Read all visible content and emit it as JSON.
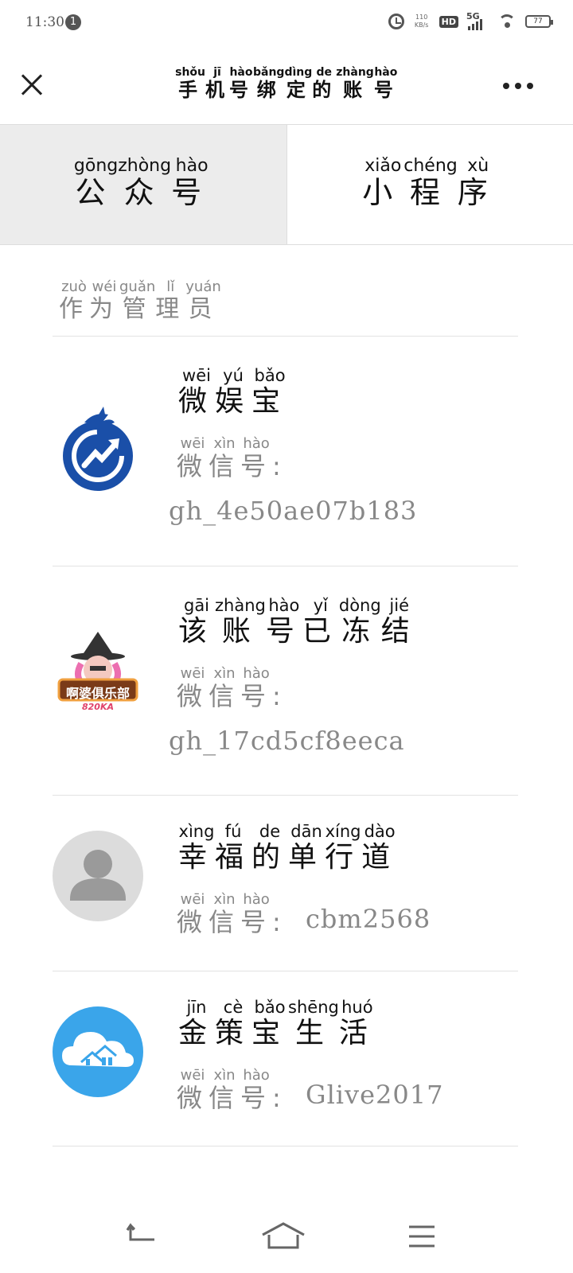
{
  "status_bar": {
    "time": "11:30",
    "notification_count": "1",
    "speed_value": "110",
    "speed_unit": "KB/s",
    "hd_label": "HD",
    "network_label": "5G",
    "battery_level": "77"
  },
  "header": {
    "title_chars": [
      "手",
      "机",
      "号",
      "绑",
      "定",
      "的",
      "账",
      "号"
    ],
    "title_pinyin": [
      "shǒu",
      "jī",
      "hào",
      "bǎng",
      "dìng",
      "de",
      "zhàng",
      "hào"
    ]
  },
  "tabs": [
    {
      "label_chars": [
        "公",
        "众",
        "号"
      ],
      "label_pinyin": [
        "gōng",
        "zhòng",
        "hào"
      ],
      "active": true
    },
    {
      "label_chars": [
        "小",
        "程",
        "序"
      ],
      "label_pinyin": [
        "xiǎo",
        "chéng",
        "xù"
      ],
      "active": false
    }
  ],
  "section": {
    "chars": [
      "作",
      "为",
      "管",
      "理",
      "员"
    ],
    "pinyin": [
      "zuò",
      "wéi",
      "guǎn",
      "lǐ",
      "yuán"
    ]
  },
  "wx_label": {
    "chars": [
      "微",
      "信",
      "号"
    ],
    "pinyin": [
      "wēi",
      "xìn",
      "hào"
    ],
    "colon": ":"
  },
  "accounts": [
    {
      "name_chars": [
        "微",
        "娱",
        "宝"
      ],
      "name_pinyin": [
        "wēi",
        "yú",
        "bǎo"
      ],
      "wechat_id": "gh_4e50ae07b183",
      "avatar": "dragon-logo-icon"
    },
    {
      "name_chars": [
        "该",
        "账",
        "号",
        "已",
        "冻",
        "结"
      ],
      "name_pinyin": [
        "gāi",
        "zhàng",
        "hào",
        "yǐ",
        "dòng",
        "jié"
      ],
      "wechat_id": "gh_17cd5cf8eeca",
      "avatar": "club-logo-icon",
      "avatar_text": "啊婆俱乐部",
      "avatar_subtext": "820KA"
    },
    {
      "name_chars": [
        "幸",
        "福",
        "的",
        "单",
        "行",
        "道"
      ],
      "name_pinyin": [
        "xìng",
        "fú",
        "de",
        "dān",
        "xíng",
        "dào"
      ],
      "wechat_id": "cbm2568",
      "avatar": "default-user-icon"
    },
    {
      "name_chars": [
        "金",
        "策",
        "宝",
        "生",
        "活"
      ],
      "name_pinyin": [
        "jīn",
        "cè",
        "bǎo",
        "shēng",
        "huó"
      ],
      "wechat_id": "Glive2017",
      "avatar": "cloud-house-icon"
    }
  ],
  "colors": {
    "active_tab_bg": "#ececec",
    "muted_text": "#888888",
    "cloud_blue": "#3aa5ea",
    "dragon_blue": "#1a4fa8"
  }
}
